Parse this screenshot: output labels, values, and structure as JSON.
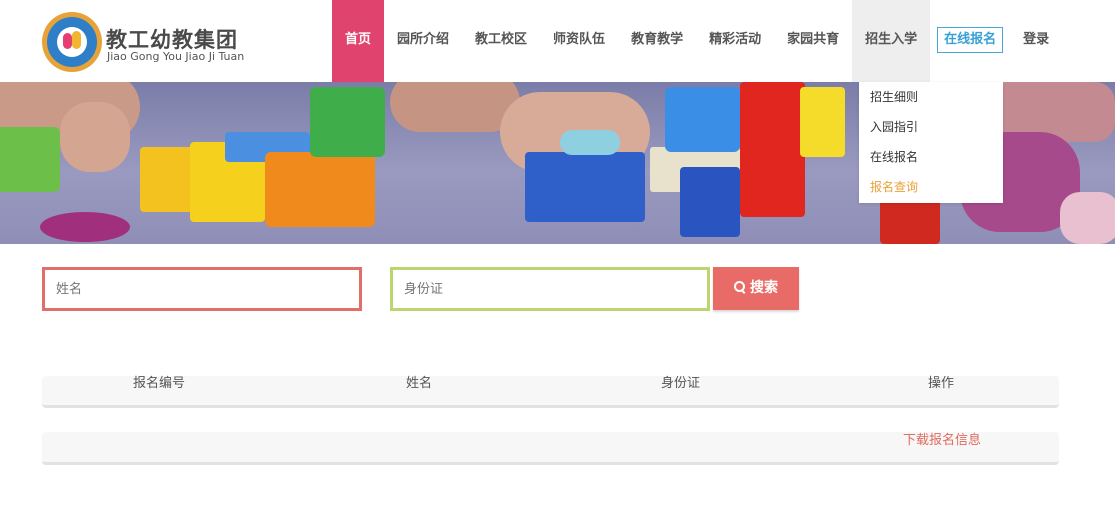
{
  "brand": {
    "name_cn": "教工幼教集团",
    "name_en": "Jiao Gong You Jiao Ji Tuan"
  },
  "nav": {
    "items": [
      {
        "label": "首页"
      },
      {
        "label": "园所介绍"
      },
      {
        "label": "教工校区"
      },
      {
        "label": "师资队伍"
      },
      {
        "label": "教育教学"
      },
      {
        "label": "精彩活动"
      },
      {
        "label": "家园共育"
      },
      {
        "label": "招生入学"
      },
      {
        "label": "在线报名"
      },
      {
        "label": "登录"
      }
    ],
    "active_index": 0,
    "open_menu": {
      "parent": "招生入学",
      "items": [
        {
          "label": "招生细则"
        },
        {
          "label": "入园指引"
        },
        {
          "label": "在线报名"
        },
        {
          "label": "报名查询"
        }
      ],
      "highlighted": "报名查询"
    }
  },
  "search": {
    "name_placeholder": "姓名",
    "id_placeholder": "身份证",
    "button_label": "搜索"
  },
  "table": {
    "columns": [
      "报名编号",
      "姓名",
      "身份证",
      "操作"
    ],
    "download_label": "下载报名信息"
  },
  "colors": {
    "nav_active": "#e0436d",
    "online_signup_border": "#4aa6d8",
    "name_field_border": "#e06f6a",
    "id_field_border": "#bcd56f",
    "search_button": "#e96b67",
    "download_link": "#e06b5f",
    "dropdown_highlight": "#e8a23a"
  }
}
